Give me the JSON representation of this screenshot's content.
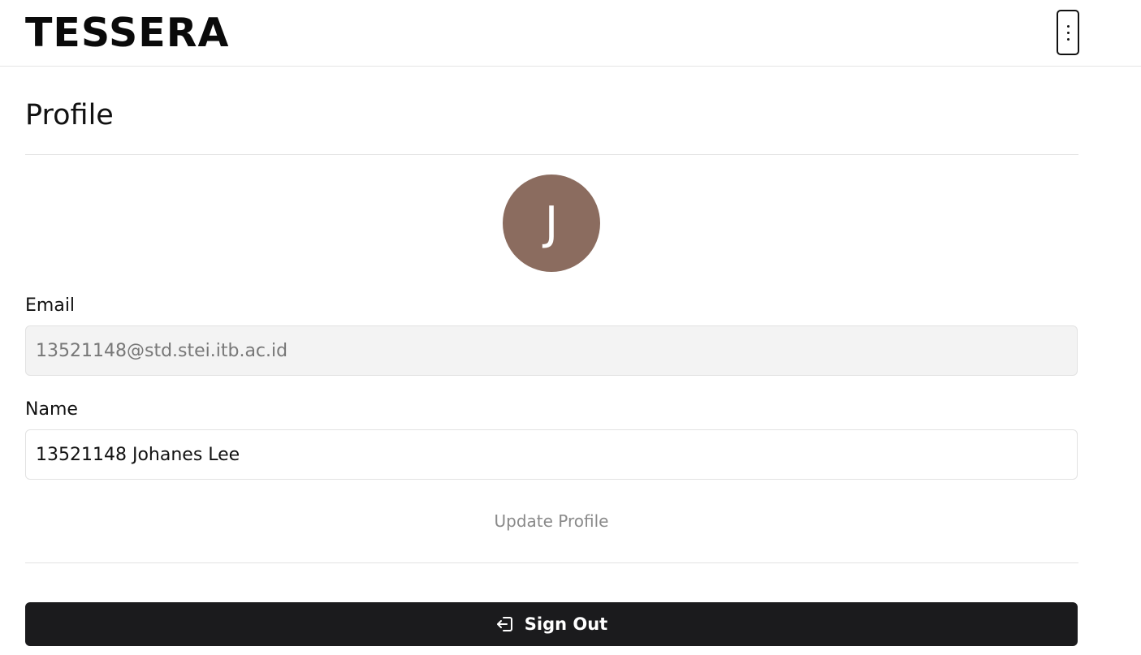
{
  "header": {
    "logo": "TESSERA",
    "menu_icon": "more-vertical-icon"
  },
  "page": {
    "title": "Profile"
  },
  "avatar": {
    "initial": "J",
    "color": "#8b6c5f"
  },
  "form": {
    "email_label": "Email",
    "email_value": "13521148@std.stei.itb.ac.id",
    "name_label": "Name",
    "name_value": "13521148 Johanes Lee",
    "update_label": "Update Profile"
  },
  "signout": {
    "label": "Sign Out",
    "icon": "sign-out-icon",
    "background": "#1b1b1d"
  }
}
